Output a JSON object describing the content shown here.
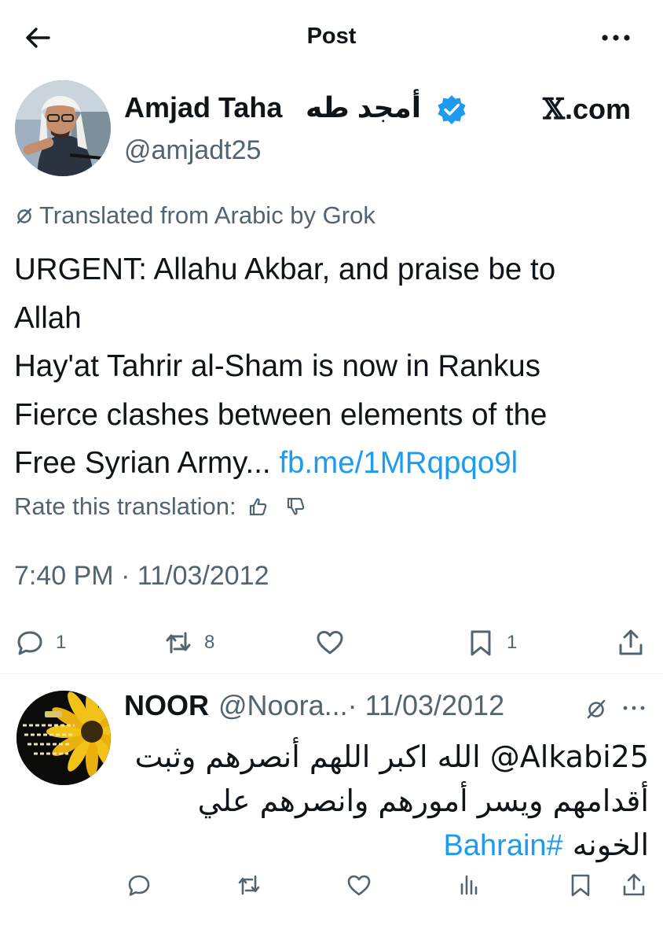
{
  "header": {
    "title": "Post"
  },
  "tweet": {
    "author_name": "Amjad Taha",
    "author_name_ar": "أمجد طه",
    "handle": "@amjadt25",
    "source": ".com",
    "translated_note": "Translated from Arabic by Grok",
    "text_lines": [
      "URGENT: Allahu Akbar, and praise be to",
      "Allah",
      "Hay'at Tahrir al-Sham is now in Rankus",
      "Fierce clashes between elements of the"
    ],
    "text_last_prefix": "Free Syrian Army...",
    "text_link": "fb.me/1MRqpqo9l",
    "rate_label": "Rate this translation:",
    "timestamp": "7:40 PM · 11/03/2012",
    "counts": {
      "replies": "1",
      "reposts": "8",
      "bookmarks": "1"
    }
  },
  "reply": {
    "name": "NOOR",
    "handle": "@Noora...",
    "date": " · 11/03/2012",
    "lines": [
      "Alkabi25@ الله اكبر اللهم أنصرهم وثبت",
      "أقدامهم ويسر أمورهم وانصرهم علي"
    ],
    "last_line_prefix": "الخونه ",
    "hashtag": "#Bahrain"
  },
  "colors": {
    "text": "#0f1419",
    "secondary": "#536471",
    "link": "#1d9bf0",
    "verified": "#1d9bf0"
  },
  "icons": [
    "back-arrow-icon",
    "more-icon",
    "verified-badge-icon",
    "translate-icon",
    "thumbs-up-icon",
    "thumbs-down-icon",
    "reply-icon",
    "repost-icon",
    "like-icon",
    "bookmark-icon",
    "share-icon",
    "views-icon"
  ]
}
